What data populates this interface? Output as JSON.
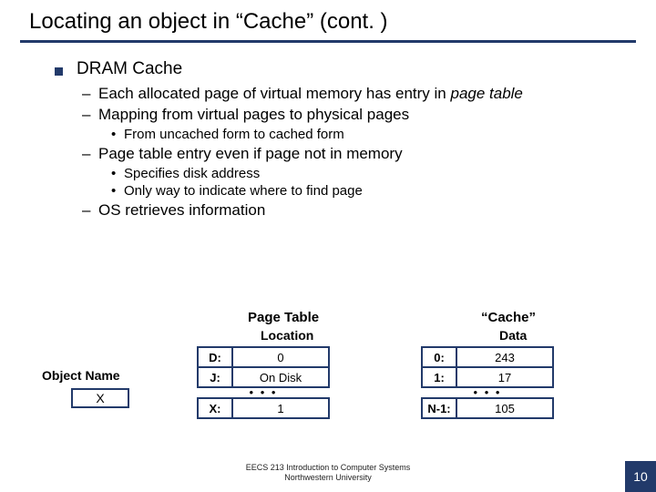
{
  "title": "Locating an object in “Cache” (cont. )",
  "l1_1": "DRAM Cache",
  "l2_1a": "Each allocated page of virtual memory has entry in ",
  "l2_1b": "page table",
  "l2_2": "Mapping from virtual pages to physical pages",
  "l3_1": "From uncached form to cached form",
  "l2_3": "Page table entry even if page not in memory",
  "l3_2": "Specifies disk address",
  "l3_3": "Only way to indicate where to find page",
  "l2_4": "OS retrieves information",
  "diagram": {
    "obj_name_label": "Object Name",
    "obj_name": "X",
    "page_table_title": "Page Table",
    "location_label": "Location",
    "cache_title": "“Cache”",
    "data_label": "Data",
    "pt": {
      "r1k": "D:",
      "r1v": "0",
      "r2k": "J:",
      "r2v": "On Disk",
      "r3k": "X:",
      "r3v": "1"
    },
    "cache": {
      "r1k": "0:",
      "r1v": "243",
      "r2k": "1:",
      "r2v": "17",
      "r3k": "N-1:",
      "r3v": "105"
    }
  },
  "footer1": "EECS 213 Introduction to Computer Systems",
  "footer2": "Northwestern University",
  "page_num": "10"
}
